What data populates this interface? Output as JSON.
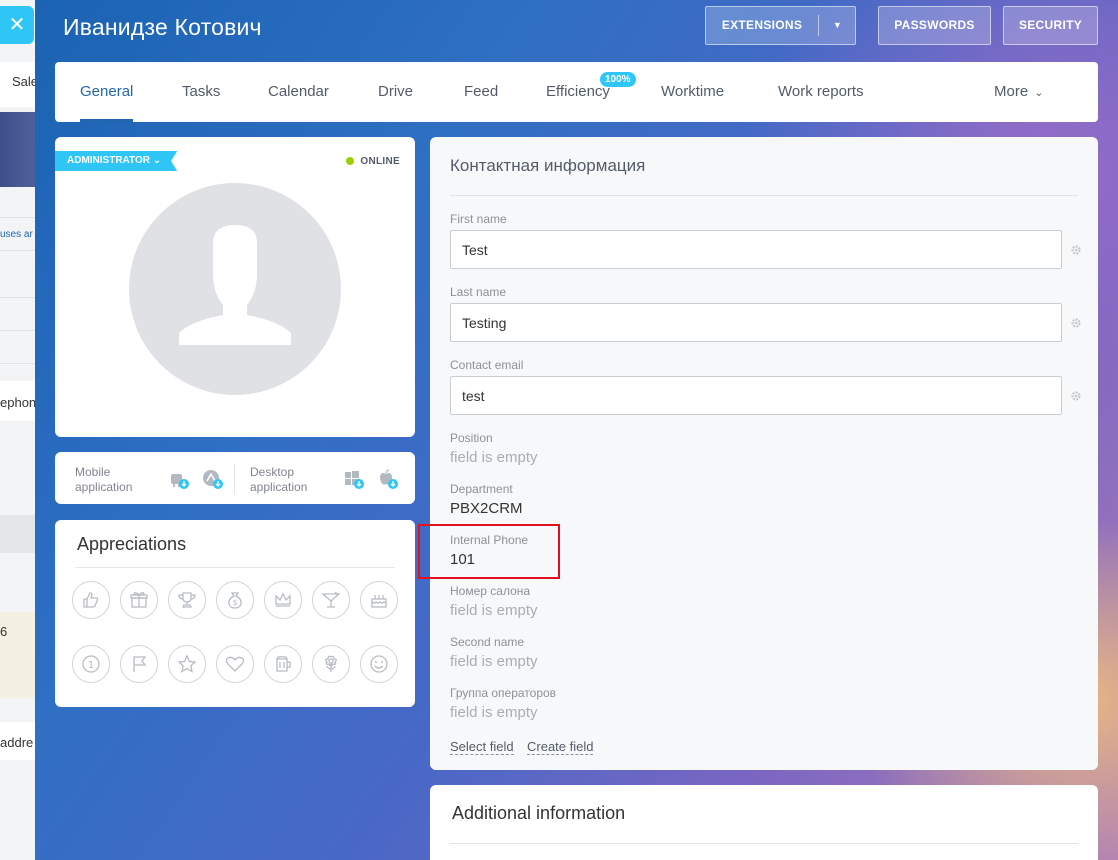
{
  "background_page": {
    "close_symbol": "✕",
    "fragments": [
      "Sale",
      "uses ar",
      "ephon",
      "6",
      "addre"
    ]
  },
  "header": {
    "user_name": "Иванидзе Котович",
    "extensions_label": "EXTENSIONS",
    "passwords_label": "PASSWORDS",
    "security_label": "SECURITY"
  },
  "tabs": {
    "items": [
      "General",
      "Tasks",
      "Calendar",
      "Drive",
      "Feed",
      "Efficiency",
      "Worktime",
      "Work reports",
      "More"
    ],
    "efficiency_badge": "100%",
    "active": "General"
  },
  "profile": {
    "role": "ADMINISTRATOR",
    "status": "ONLINE",
    "mobile_app": "Mobile application",
    "desktop_app": "Desktop application"
  },
  "appreciations": {
    "title": "Appreciations",
    "icons": [
      "thumbs-up-icon",
      "gift-icon",
      "trophy-icon",
      "money-bag-icon",
      "crown-icon",
      "cocktail-icon",
      "cake-icon",
      "number-one-icon",
      "flag-icon",
      "star-icon",
      "heart-icon",
      "beer-icon",
      "flower-icon",
      "smile-icon"
    ]
  },
  "contact": {
    "title": "Контактная информация",
    "first_name_label": "First name",
    "first_name_value": "Test",
    "last_name_label": "Last name",
    "last_name_value": "Testing",
    "email_label": "Contact email",
    "email_value": "test",
    "position_label": "Position",
    "position_value": "field is empty",
    "department_label": "Department",
    "department_value": "PBX2CRM",
    "internal_phone_label": "Internal Phone",
    "internal_phone_value": "101",
    "salon_label": "Номер салона",
    "salon_value": "field is empty",
    "second_name_label": "Second name",
    "second_name_value": "field is empty",
    "operator_group_label": "Группа операторов",
    "operator_group_value": "field is empty",
    "select_field": "Select field",
    "create_field": "Create field"
  },
  "additional": {
    "title": "Additional information"
  },
  "colors": {
    "accent": "#2fc6f6",
    "tab_active": "#2067b0",
    "online": "#9dcf00",
    "highlight": "#e0101e"
  }
}
